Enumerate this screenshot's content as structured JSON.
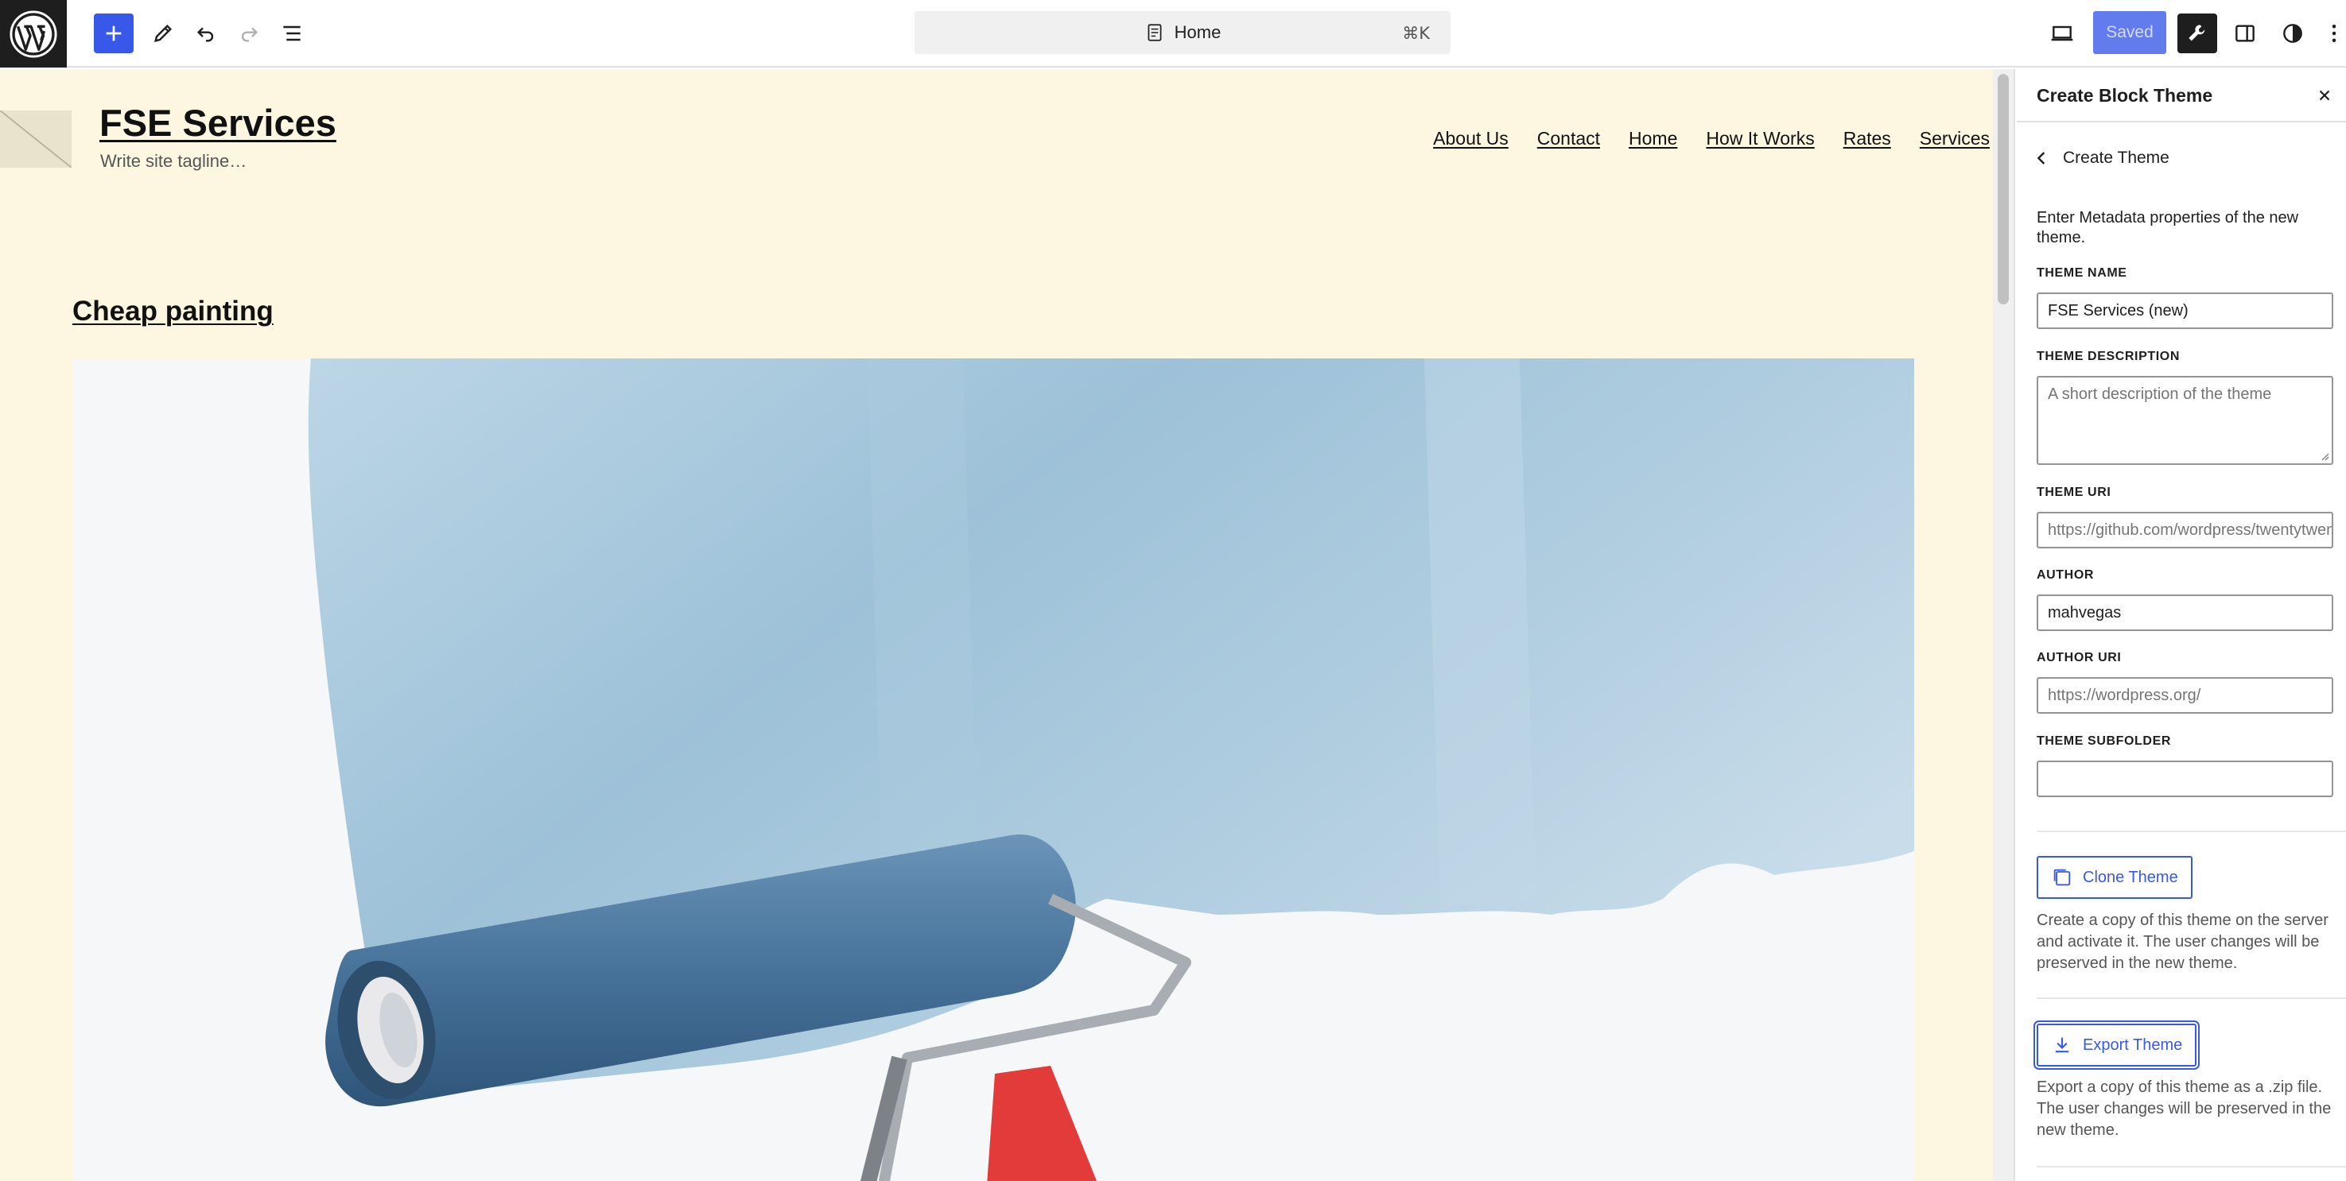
{
  "toolbar": {
    "command_title": "Home",
    "command_shortcut": "⌘K",
    "saved_label": "Saved"
  },
  "site": {
    "title": "FSE Services",
    "tagline": "Write site tagline…",
    "nav": [
      "About Us",
      "Contact",
      "Home",
      "How It Works",
      "Rates",
      "Services"
    ],
    "post_title": "Cheap painting"
  },
  "sidebar": {
    "title": "Create Block Theme",
    "back_label": "Create Theme",
    "intro": "Enter Metadata properties of the new theme.",
    "fields": {
      "theme_name": {
        "label": "THEME NAME",
        "value": "FSE Services (new)"
      },
      "theme_description": {
        "label": "THEME DESCRIPTION",
        "placeholder": "A short description of the theme"
      },
      "theme_uri": {
        "label": "THEME URI",
        "placeholder": "https://github.com/wordpress/twentytwentythree/"
      },
      "author": {
        "label": "AUTHOR",
        "value": "mahvegas"
      },
      "author_uri": {
        "label": "AUTHOR URI",
        "placeholder": "https://wordpress.org/"
      },
      "theme_subfolder": {
        "label": "THEME SUBFOLDER",
        "value": ""
      }
    },
    "clone": {
      "label": "Clone Theme",
      "description": "Create a copy of this theme on the server and activate it. The user changes will be preserved in the new theme."
    },
    "export": {
      "label": "Export Theme",
      "description": "Export a copy of this theme as a .zip file. The user changes will be preserved in the new theme."
    }
  }
}
